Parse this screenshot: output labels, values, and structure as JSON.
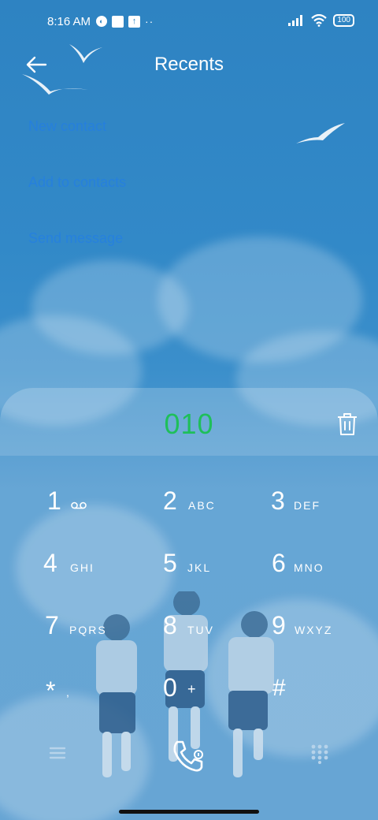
{
  "status_bar": {
    "time": "8:16 AM",
    "notification_icons": [
      "reminder-icon",
      "square-app-icon",
      "upload-icon"
    ],
    "overflow": "··",
    "battery": "100"
  },
  "header": {
    "back_icon": "back-arrow-icon",
    "title": "Recents"
  },
  "actions": [
    {
      "label": "New contact"
    },
    {
      "label": "Add to contacts"
    },
    {
      "label": "Send message"
    }
  ],
  "dialer": {
    "number": "010",
    "number_color": "#1fbf5a",
    "delete_icon": "trash-icon"
  },
  "keys": [
    {
      "digit": "1",
      "letters": ""
    },
    {
      "digit": "2",
      "letters": "ABC"
    },
    {
      "digit": "3",
      "letters": "DEF"
    },
    {
      "digit": "4",
      "letters": "GHI"
    },
    {
      "digit": "5",
      "letters": "JKL"
    },
    {
      "digit": "6",
      "letters": "MNO"
    },
    {
      "digit": "7",
      "letters": "PQRS"
    },
    {
      "digit": "8",
      "letters": "TUV"
    },
    {
      "digit": "9",
      "letters": "WXYZ"
    },
    {
      "digit": "*",
      "letters": ","
    },
    {
      "digit": "0",
      "letters": "+"
    },
    {
      "digit": "#",
      "letters": ""
    }
  ],
  "bottom_bar": {
    "menu_icon": "menu-icon",
    "call_icon": "call-sim-icon",
    "keypad_icon": "dialpad-icon"
  }
}
